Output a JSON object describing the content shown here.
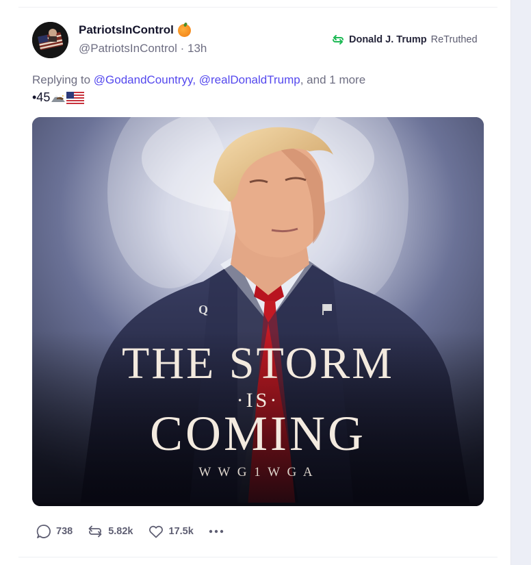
{
  "post": {
    "display_name": "PatriotsInControl",
    "handle": "@PatriotsInControl",
    "time_sep": " · ",
    "time": "13h",
    "retruth": {
      "name": "Donald J. Trump",
      "verb": "ReTruthed"
    },
    "reply": {
      "prefix": "Replying to ",
      "mention_1": "@GodandCountryy",
      "sep_1": ", ",
      "mention_2": "@realDonaldTrump",
      "suffix": ", and 1 more"
    },
    "text": "•45",
    "image": {
      "line_1": "THE STORM",
      "line_2": "·IS·",
      "line_3": "COMING",
      "line_4": "W W G 1 W G A",
      "lapel_pin": "Q"
    }
  },
  "actions": {
    "replies": "738",
    "retruths": "5.82k",
    "likes": "17.5k"
  },
  "icons": {
    "badge": "orange-fruit-icon",
    "retruth": "retruth-icon",
    "reply": "comment-bubble-icon",
    "like": "heart-icon",
    "more": "more-dots-icon",
    "eagle": "eagle-emoji-icon",
    "flag": "us-flag-emoji-icon"
  },
  "colors": {
    "accent": "#5448ee",
    "retruth_green": "#1db954",
    "text_primary": "#14142b",
    "text_secondary": "#6e6e82"
  }
}
